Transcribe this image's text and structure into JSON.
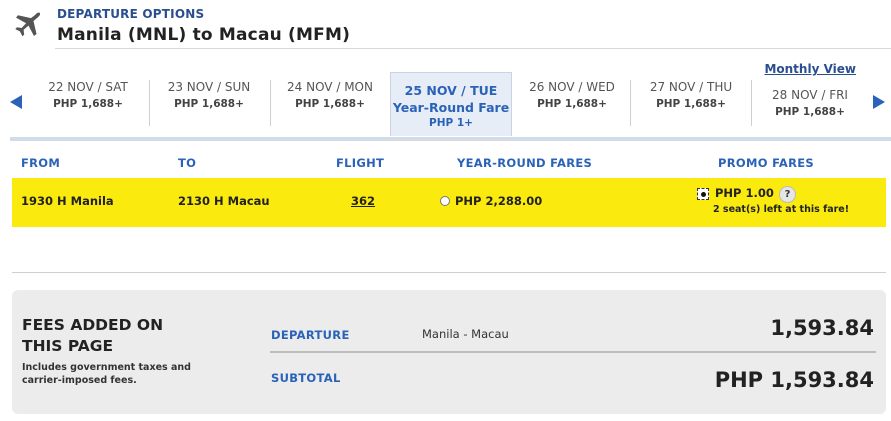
{
  "header": {
    "section_label": "DEPARTURE OPTIONS",
    "route": "Manila  (MNL) to  Macau  (MFM)"
  },
  "date_strip": {
    "monthly_view": "Monthly View",
    "days": [
      {
        "date": "22 NOV / SAT",
        "price": "PHP 1,688+"
      },
      {
        "date": "23 NOV / SUN",
        "price": "PHP 1,688+"
      },
      {
        "date": "24 NOV / MON",
        "price": "PHP 1,688+"
      },
      {
        "date": "25 NOV / TUE",
        "fare_type": "Year-Round Fare",
        "price": "PHP  1+"
      },
      {
        "date": "26 NOV / WED",
        "price": "PHP 1,688+"
      },
      {
        "date": "27 NOV / THU",
        "price": "PHP 1,688+"
      },
      {
        "date": "28 NOV / FRI",
        "price": "PHP 1,688+"
      }
    ]
  },
  "columns": {
    "from": "FROM",
    "to": "TO",
    "flight": "FLIGHT",
    "year_round": "YEAR-ROUND FARES",
    "promo": "PROMO FARES"
  },
  "flight_row": {
    "departure": "1930 H  Manila",
    "arrival": "2130 H  Macau",
    "flight_no": "362",
    "year_round_fare": "PHP  2,288.00",
    "promo_fare": "PHP  1.00",
    "help": "?",
    "seats_left": "2 seat(s) left at this fare!",
    "selected": "promo"
  },
  "fees": {
    "title": "FEES ADDED ON THIS PAGE",
    "note": "Includes government taxes and carrier-imposed fees.",
    "departure_label": "DEPARTURE",
    "departure_route": "Manila - Macau",
    "departure_amount": "1,593.84",
    "subtotal_label": "SUBTOTAL",
    "subtotal_amount": "PHP  1,593.84"
  },
  "colors": {
    "accent_blue": "#2a62b8",
    "row_highlight": "#fbea0d",
    "panel_gray": "#ececec"
  }
}
